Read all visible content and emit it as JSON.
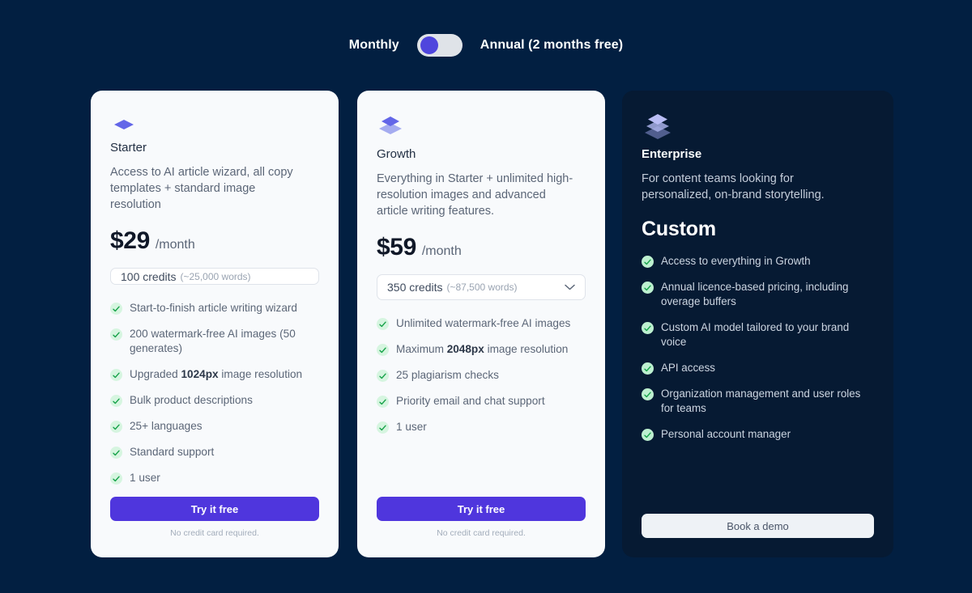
{
  "billing": {
    "monthly_label": "Monthly",
    "annual_label": "Annual (2 months free)",
    "selected": "Monthly",
    "toggle_position": "left"
  },
  "colors": {
    "page_background": "#021f41",
    "card_light_background": "#f8fafc",
    "card_dark_background": "#061a33",
    "accent_purple": "#4f36dd",
    "toggle_track": "#dfe3e8",
    "check_badge_green": "#d6f5e0",
    "check_mark_green": "#17a34a"
  },
  "plans": [
    {
      "id": "starter",
      "icon": "single-layer-diamond-icon",
      "icon_layers": 1,
      "name": "Starter",
      "description": "Access to AI article wizard, all copy templates + standard image resolution",
      "price_amount": "$29",
      "price_period": "/month",
      "credits": {
        "main": "100 credits",
        "sub": "(~25,000 words)",
        "has_caret": false
      },
      "features": [
        {
          "text": "Start-to-finish article writing wizard"
        },
        {
          "text": "200 watermark-free AI images (50 generates)"
        },
        {
          "pre": "Upgraded ",
          "bold": "1024px",
          "post": " image resolution"
        },
        {
          "text": "Bulk product descriptions"
        },
        {
          "text": "25+ languages"
        },
        {
          "text": "Standard support"
        },
        {
          "text": "1 user"
        }
      ],
      "cta_label": "Try it free",
      "cta_style": "primary",
      "cta_note": "No credit card required."
    },
    {
      "id": "growth",
      "icon": "double-layer-stack-icon",
      "icon_layers": 2,
      "name": "Growth",
      "description": "Everything in Starter + unlimited high-resolution images and advanced article writing features.",
      "price_amount": "$59",
      "price_period": "/month",
      "credits": {
        "main": "350 credits",
        "sub": "(~87,500 words)",
        "has_caret": true
      },
      "features": [
        {
          "text": "Unlimited watermark-free AI images"
        },
        {
          "pre": "Maximum ",
          "bold": "2048px",
          "post": " image resolution"
        },
        {
          "text": "25 plagiarism checks"
        },
        {
          "text": "Priority email and chat support"
        },
        {
          "text": "1 user"
        }
      ],
      "cta_label": "Try it free",
      "cta_style": "primary",
      "cta_note": "No credit card required."
    },
    {
      "id": "enterprise",
      "icon": "triple-layer-stack-icon",
      "icon_layers": 3,
      "name": "Enterprise",
      "description": "For content teams looking for personalized, on-brand storytelling.",
      "price_amount": "Custom",
      "price_period": "",
      "credits": null,
      "features": [
        {
          "text": "Access to everything in Growth"
        },
        {
          "text": "Annual licence-based pricing, including overage buffers"
        },
        {
          "text": "Custom AI model tailored to your brand voice"
        },
        {
          "text": "API access"
        },
        {
          "text": "Organization management and user roles for teams"
        },
        {
          "text": "Personal account manager"
        }
      ],
      "cta_label": "Book a demo",
      "cta_style": "ghost",
      "cta_note": ""
    }
  ]
}
